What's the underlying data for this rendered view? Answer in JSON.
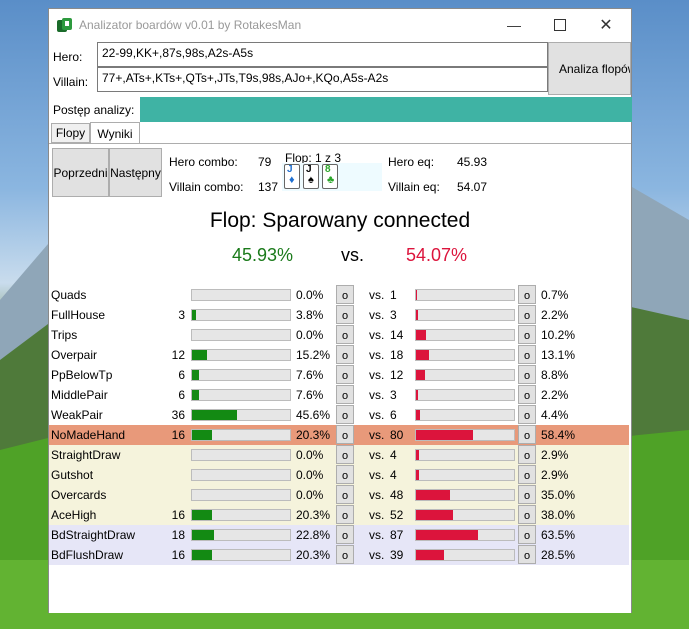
{
  "window": {
    "title": "Analizator boardów v0.01 by RotakesMan"
  },
  "form": {
    "hero_label": "Hero:",
    "hero_value": "22-99,KK+,87s,98s,A2s-A5s",
    "villain_label": "Villain:",
    "villain_value": "77+,ATs+,KTs+,QTs+,JTs,T9s,98s,AJo+,KQo,A5s-A2s",
    "analyze_button": "Analiza flopów",
    "progress_label": "Postęp analizy:",
    "progress_value": 1.0
  },
  "tabs": [
    "Flopy",
    "Wyniki"
  ],
  "nav": {
    "prev": "Poprzedni",
    "next": "Następny"
  },
  "stats": {
    "hero_combo_label": "Hero combo:",
    "hero_combo": "79",
    "villain_combo_label": "Villain combo:",
    "villain_combo": "137",
    "flop_label": "Flop: 1 z 3",
    "hero_eq_label": "Hero eq:",
    "hero_eq": "45.93",
    "villain_eq_label": "Villain eq:",
    "villain_eq": "54.07"
  },
  "cards": [
    {
      "rank": "J",
      "suit": "♦",
      "color": "#1e6fd0"
    },
    {
      "rank": "J",
      "suit": "♠",
      "color": "#000000"
    },
    {
      "rank": "8",
      "suit": "♣",
      "color": "#2aa52a"
    }
  ],
  "flop_title": "Flop: Sparowany connected",
  "hero_pct": "45.93%",
  "vs_label": "vs.",
  "villain_pct": "54.07%",
  "colors": {
    "hero": "#1a7a1a",
    "villain": "#dc143c",
    "hero_bar": "#138a13",
    "villain_bar": "#dc143c",
    "highlight": "#e8997a",
    "draw_bg": "#f5f3dc",
    "backdoor_bg": "#e6e6f7"
  },
  "rows": [
    {
      "name": "Quads",
      "hero_n": "",
      "hero_pct": "0.0%",
      "hero_frac": 0.0,
      "vs": "vs.",
      "vil_n": "1",
      "vil_pct": "0.7%",
      "vil_frac": 0.007,
      "btn": "o",
      "group": "none"
    },
    {
      "name": "FullHouse",
      "hero_n": "3",
      "hero_pct": "3.8%",
      "hero_frac": 0.038,
      "vs": "vs.",
      "vil_n": "3",
      "vil_pct": "2.2%",
      "vil_frac": 0.022,
      "btn": "o",
      "group": "none"
    },
    {
      "name": "Trips",
      "hero_n": "",
      "hero_pct": "0.0%",
      "hero_frac": 0.0,
      "vs": "vs.",
      "vil_n": "14",
      "vil_pct": "10.2%",
      "vil_frac": 0.102,
      "btn": "o",
      "group": "none"
    },
    {
      "name": "Overpair",
      "hero_n": "12",
      "hero_pct": "15.2%",
      "hero_frac": 0.152,
      "vs": "vs.",
      "vil_n": "18",
      "vil_pct": "13.1%",
      "vil_frac": 0.131,
      "btn": "o",
      "group": "none"
    },
    {
      "name": "PpBelowTp",
      "hero_n": "6",
      "hero_pct": "7.6%",
      "hero_frac": 0.076,
      "vs": "vs.",
      "vil_n": "12",
      "vil_pct": "8.8%",
      "vil_frac": 0.088,
      "btn": "o",
      "group": "none"
    },
    {
      "name": "MiddlePair",
      "hero_n": "6",
      "hero_pct": "7.6%",
      "hero_frac": 0.076,
      "vs": "vs.",
      "vil_n": "3",
      "vil_pct": "2.2%",
      "vil_frac": 0.022,
      "btn": "o",
      "group": "none"
    },
    {
      "name": "WeakPair",
      "hero_n": "36",
      "hero_pct": "45.6%",
      "hero_frac": 0.456,
      "vs": "vs.",
      "vil_n": "6",
      "vil_pct": "4.4%",
      "vil_frac": 0.044,
      "btn": "o",
      "group": "none"
    },
    {
      "name": "NoMadeHand",
      "hero_n": "16",
      "hero_pct": "20.3%",
      "hero_frac": 0.203,
      "vs": "vs.",
      "vil_n": "80",
      "vil_pct": "58.4%",
      "vil_frac": 0.584,
      "btn": "o",
      "group": "highlight"
    },
    {
      "name": "StraightDraw",
      "hero_n": "",
      "hero_pct": "0.0%",
      "hero_frac": 0.0,
      "vs": "vs.",
      "vil_n": "4",
      "vil_pct": "2.9%",
      "vil_frac": 0.029,
      "btn": "o",
      "group": "draw"
    },
    {
      "name": "Gutshot",
      "hero_n": "",
      "hero_pct": "0.0%",
      "hero_frac": 0.0,
      "vs": "vs.",
      "vil_n": "4",
      "vil_pct": "2.9%",
      "vil_frac": 0.029,
      "btn": "o",
      "group": "draw"
    },
    {
      "name": "Overcards",
      "hero_n": "",
      "hero_pct": "0.0%",
      "hero_frac": 0.0,
      "vs": "vs.",
      "vil_n": "48",
      "vil_pct": "35.0%",
      "vil_frac": 0.35,
      "btn": "o",
      "group": "draw"
    },
    {
      "name": "AceHigh",
      "hero_n": "16",
      "hero_pct": "20.3%",
      "hero_frac": 0.203,
      "vs": "vs.",
      "vil_n": "52",
      "vil_pct": "38.0%",
      "vil_frac": 0.38,
      "btn": "o",
      "group": "draw"
    },
    {
      "name": "BdStraightDraw",
      "hero_n": "18",
      "hero_pct": "22.8%",
      "hero_frac": 0.228,
      "vs": "vs.",
      "vil_n": "87",
      "vil_pct": "63.5%",
      "vil_frac": 0.635,
      "btn": "o",
      "group": "backdoor"
    },
    {
      "name": "BdFlushDraw",
      "hero_n": "16",
      "hero_pct": "20.3%",
      "hero_frac": 0.203,
      "vs": "vs.",
      "vil_n": "39",
      "vil_pct": "28.5%",
      "vil_frac": 0.285,
      "btn": "o",
      "group": "backdoor"
    }
  ]
}
